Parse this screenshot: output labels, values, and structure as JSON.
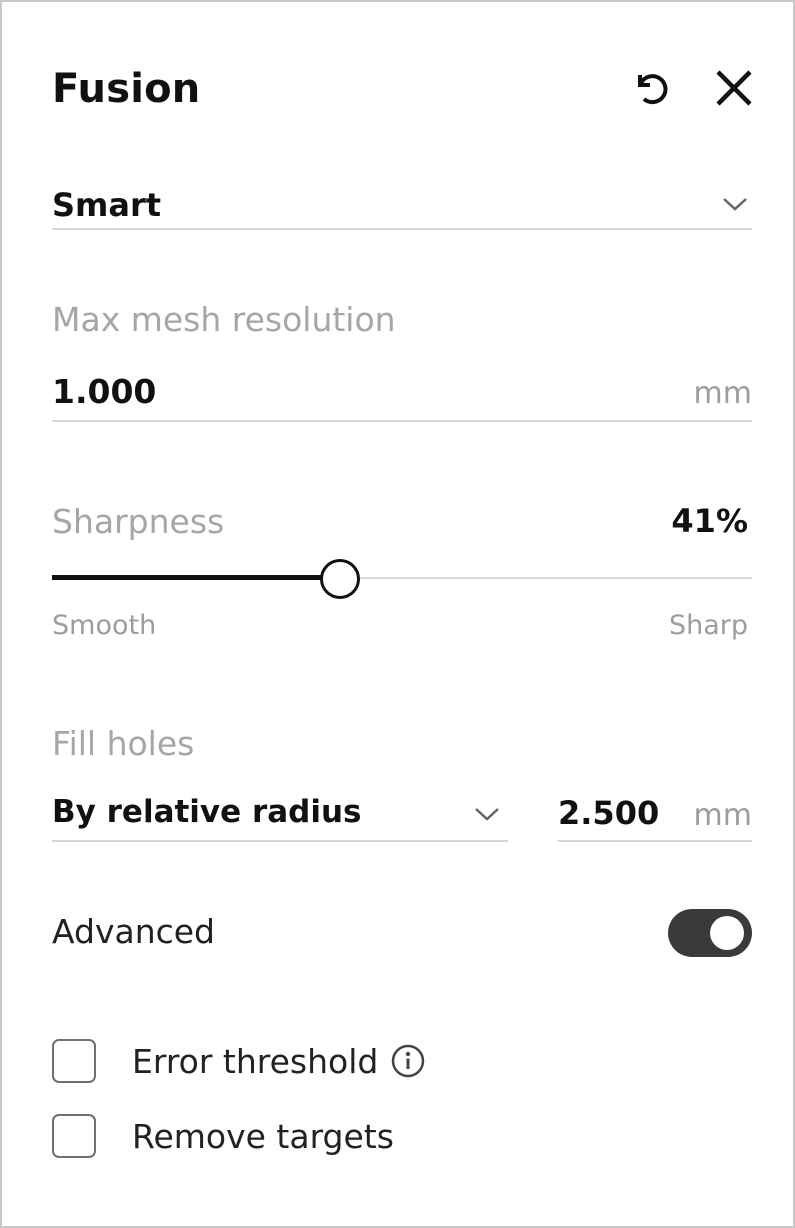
{
  "header": {
    "title": "Fusion",
    "reset_icon": "undo-arrow-icon",
    "close_icon": "close-x-icon"
  },
  "mode_select": {
    "value": "Smart",
    "icon": "chevron-down-icon"
  },
  "max_mesh": {
    "label": "Max mesh resolution",
    "value": "1.000",
    "unit": "mm"
  },
  "sharpness": {
    "label": "Sharpness",
    "value_text": "41%",
    "value": 0.41,
    "min_label": "Smooth",
    "max_label": "Sharp"
  },
  "fill_holes": {
    "label": "Fill holes",
    "method": "By relative radius",
    "radius_value": "2.500",
    "unit": "mm",
    "icon": "chevron-down-icon"
  },
  "advanced": {
    "label": "Advanced",
    "enabled": true,
    "accent": "#3a3a3a"
  },
  "options": [
    {
      "label": "Error threshold",
      "checked": false,
      "info_icon": "info-circle-icon"
    },
    {
      "label": "Remove targets",
      "checked": false
    }
  ]
}
